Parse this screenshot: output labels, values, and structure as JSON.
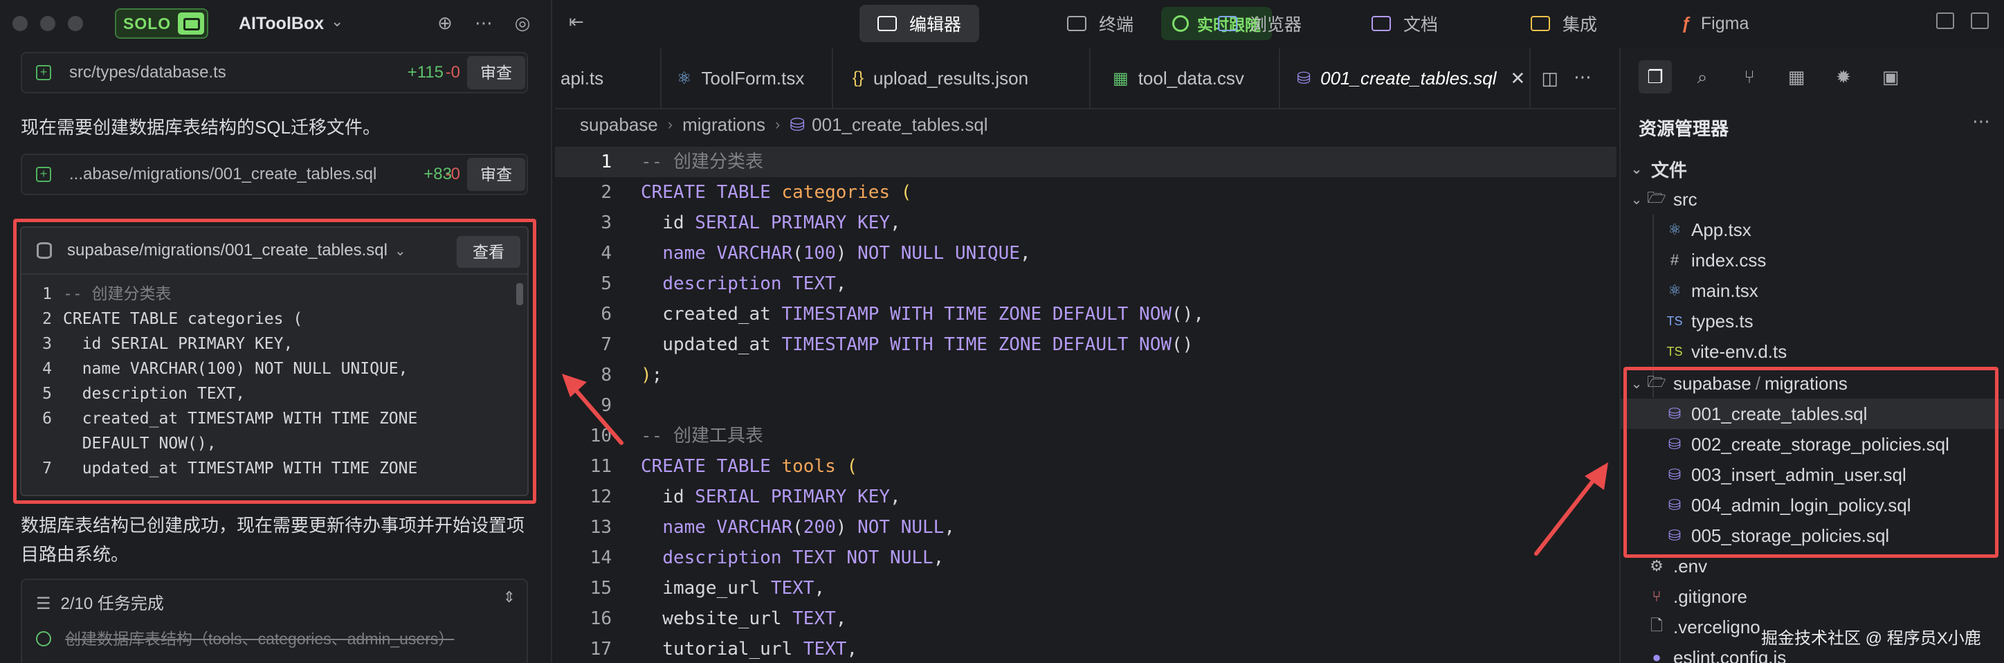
{
  "left_panel": {
    "solo_label": "SOLO",
    "app_name": "AIToolBox",
    "file_card_1": {
      "path": "src/types/database.ts",
      "added": "+115",
      "removed": "-0",
      "button": "审查"
    },
    "message_1": "现在需要创建数据库表结构的SQL迁移文件。",
    "file_card_2": {
      "path": "...abase/migrations/001_create_tables.sql",
      "added": "+83",
      "removed": "-0",
      "button": "审查"
    },
    "sql_card": {
      "path": "supabase/migrations/001_create_tables.sql",
      "button": "查看",
      "lines": [
        {
          "n": "1",
          "text": "-- 创建分类表"
        },
        {
          "n": "2",
          "text": "CREATE TABLE categories ("
        },
        {
          "n": "3",
          "text": "  id SERIAL PRIMARY KEY,"
        },
        {
          "n": "4",
          "text": "  name VARCHAR(100) NOT NULL UNIQUE,"
        },
        {
          "n": "5",
          "text": "  description TEXT,"
        },
        {
          "n": "6",
          "text": "  created_at TIMESTAMP WITH TIME ZONE"
        },
        {
          "n": "",
          "text": "  DEFAULT NOW(),"
        },
        {
          "n": "7",
          "text": "  updated_at TIMESTAMP WITH TIME ZONE"
        }
      ]
    },
    "message_2": "数据库表结构已创建成功，现在需要更新待办事项并开始设置项目路由系统。",
    "tasks": {
      "header": "2/10 任务完成",
      "done_item": "创建数据库表结构（tools、categories、admin_users）"
    }
  },
  "top_bar": {
    "live_label": "实时跟随",
    "tabs": [
      "编辑器",
      "终端",
      "浏览器",
      "文档",
      "集成",
      "Figma"
    ]
  },
  "editor": {
    "tabs": [
      {
        "label": "api.ts",
        "icon": "ts-file-icon"
      },
      {
        "label": "ToolForm.tsx",
        "icon": "react-icon"
      },
      {
        "label": "upload_results.json",
        "icon": "json-icon"
      },
      {
        "label": "tool_data.csv",
        "icon": "table-icon"
      },
      {
        "label": "001_create_tables.sql",
        "icon": "database-icon"
      }
    ],
    "breadcrumb": [
      "supabase",
      "migrations",
      "001_create_tables.sql"
    ],
    "code_lines": [
      "1",
      "2",
      "3",
      "4",
      "5",
      "6",
      "7",
      "8",
      "9",
      "10",
      "11",
      "12",
      "13",
      "14",
      "15",
      "16",
      "17"
    ]
  },
  "explorer": {
    "title": "资源管理器",
    "section": "文件",
    "items": [
      {
        "label": "src",
        "type": "folder"
      },
      {
        "label": "App.tsx",
        "type": "react"
      },
      {
        "label": "index.css",
        "type": "css"
      },
      {
        "label": "main.tsx",
        "type": "react"
      },
      {
        "label": "types.ts",
        "type": "ts"
      },
      {
        "label": "vite-env.d.ts",
        "type": "ts"
      },
      {
        "label": "supabase",
        "type": "folder"
      },
      {
        "label": "migrations",
        "type": "folder"
      },
      {
        "label": "001_create_tables.sql",
        "type": "sql"
      },
      {
        "label": "002_create_storage_policies.sql",
        "type": "sql"
      },
      {
        "label": "003_insert_admin_user.sql",
        "type": "sql"
      },
      {
        "label": "004_admin_login_policy.sql",
        "type": "sql"
      },
      {
        "label": "005_storage_policies.sql",
        "type": "sql"
      },
      {
        "label": ".env",
        "type": "gear"
      },
      {
        "label": ".gitignore",
        "type": "git"
      },
      {
        "label": ".verceligno",
        "type": "file"
      },
      {
        "label": "eslint.config.js",
        "type": "js"
      }
    ]
  },
  "watermark": "掘金技术社区 @ 程序员X小鹿",
  "colors": {
    "accent_green": "#7dde6a",
    "highlight_red": "#ea4b4b",
    "keyword": "#b49bf4",
    "identifier": "#f2a65a"
  }
}
